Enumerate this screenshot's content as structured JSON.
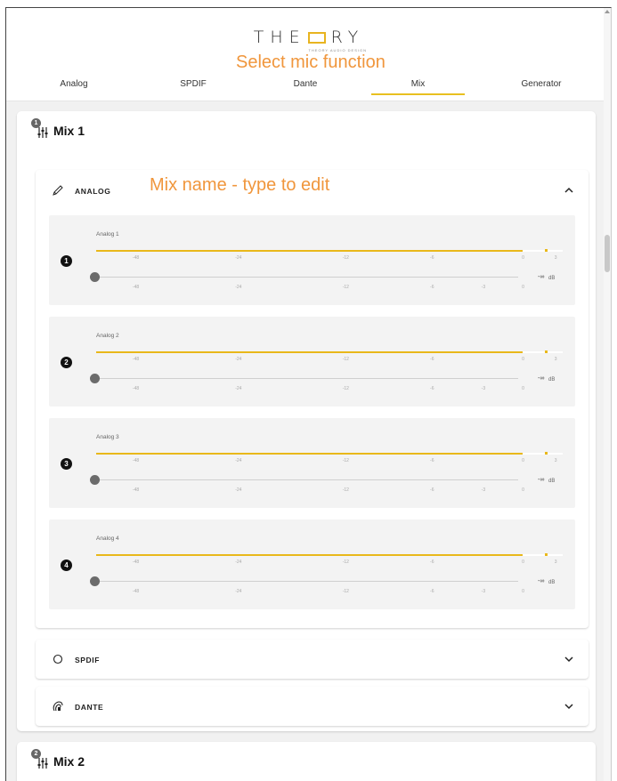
{
  "header": {
    "logo_text": "THEORY",
    "logo_subtitle": "THEORY AUDIO DESIGN",
    "annotation": "Select mic function",
    "tabs": [
      {
        "label": "Analog",
        "active": false
      },
      {
        "label": "SPDIF",
        "active": false
      },
      {
        "label": "Dante",
        "active": false
      },
      {
        "label": "Mix",
        "active": true
      },
      {
        "label": "Generator",
        "active": false
      }
    ]
  },
  "mixes": [
    {
      "badge": "1",
      "label": "Mix 1",
      "sections": {
        "analog": {
          "label": "ANALOG",
          "annotation": "Mix name - type to edit",
          "expanded": true,
          "channels": [
            {
              "badge": "1",
              "name": "Analog 1",
              "meter_level_db": 0,
              "peak_db": 2,
              "fader_value": "-∞",
              "unit": "dB"
            },
            {
              "badge": "2",
              "name": "Analog 2",
              "meter_level_db": 0,
              "peak_db": 2,
              "fader_value": "-∞",
              "unit": "dB"
            },
            {
              "badge": "3",
              "name": "Analog 3",
              "meter_level_db": 0,
              "peak_db": 2,
              "fader_value": "-∞",
              "unit": "dB"
            },
            {
              "badge": "4",
              "name": "Analog 4",
              "meter_level_db": 0,
              "peak_db": 2,
              "fader_value": "-∞",
              "unit": "dB"
            }
          ],
          "meter_scale": [
            "-48",
            "-24",
            "-12",
            "-6",
            "0",
            "3"
          ],
          "fader_scale": [
            "-48",
            "-24",
            "-12",
            "-6",
            "-3",
            "0"
          ]
        },
        "spdif": {
          "label": "SPDIF",
          "expanded": false
        },
        "dante": {
          "label": "DANTE",
          "expanded": false
        }
      }
    },
    {
      "badge": "2",
      "label": "Mix 2"
    }
  ],
  "colors": {
    "accent": "#e9b81a",
    "annotation": "#f0963c",
    "panel_bg": "#f3f3f3",
    "page_bg": "#f1f1f1"
  }
}
